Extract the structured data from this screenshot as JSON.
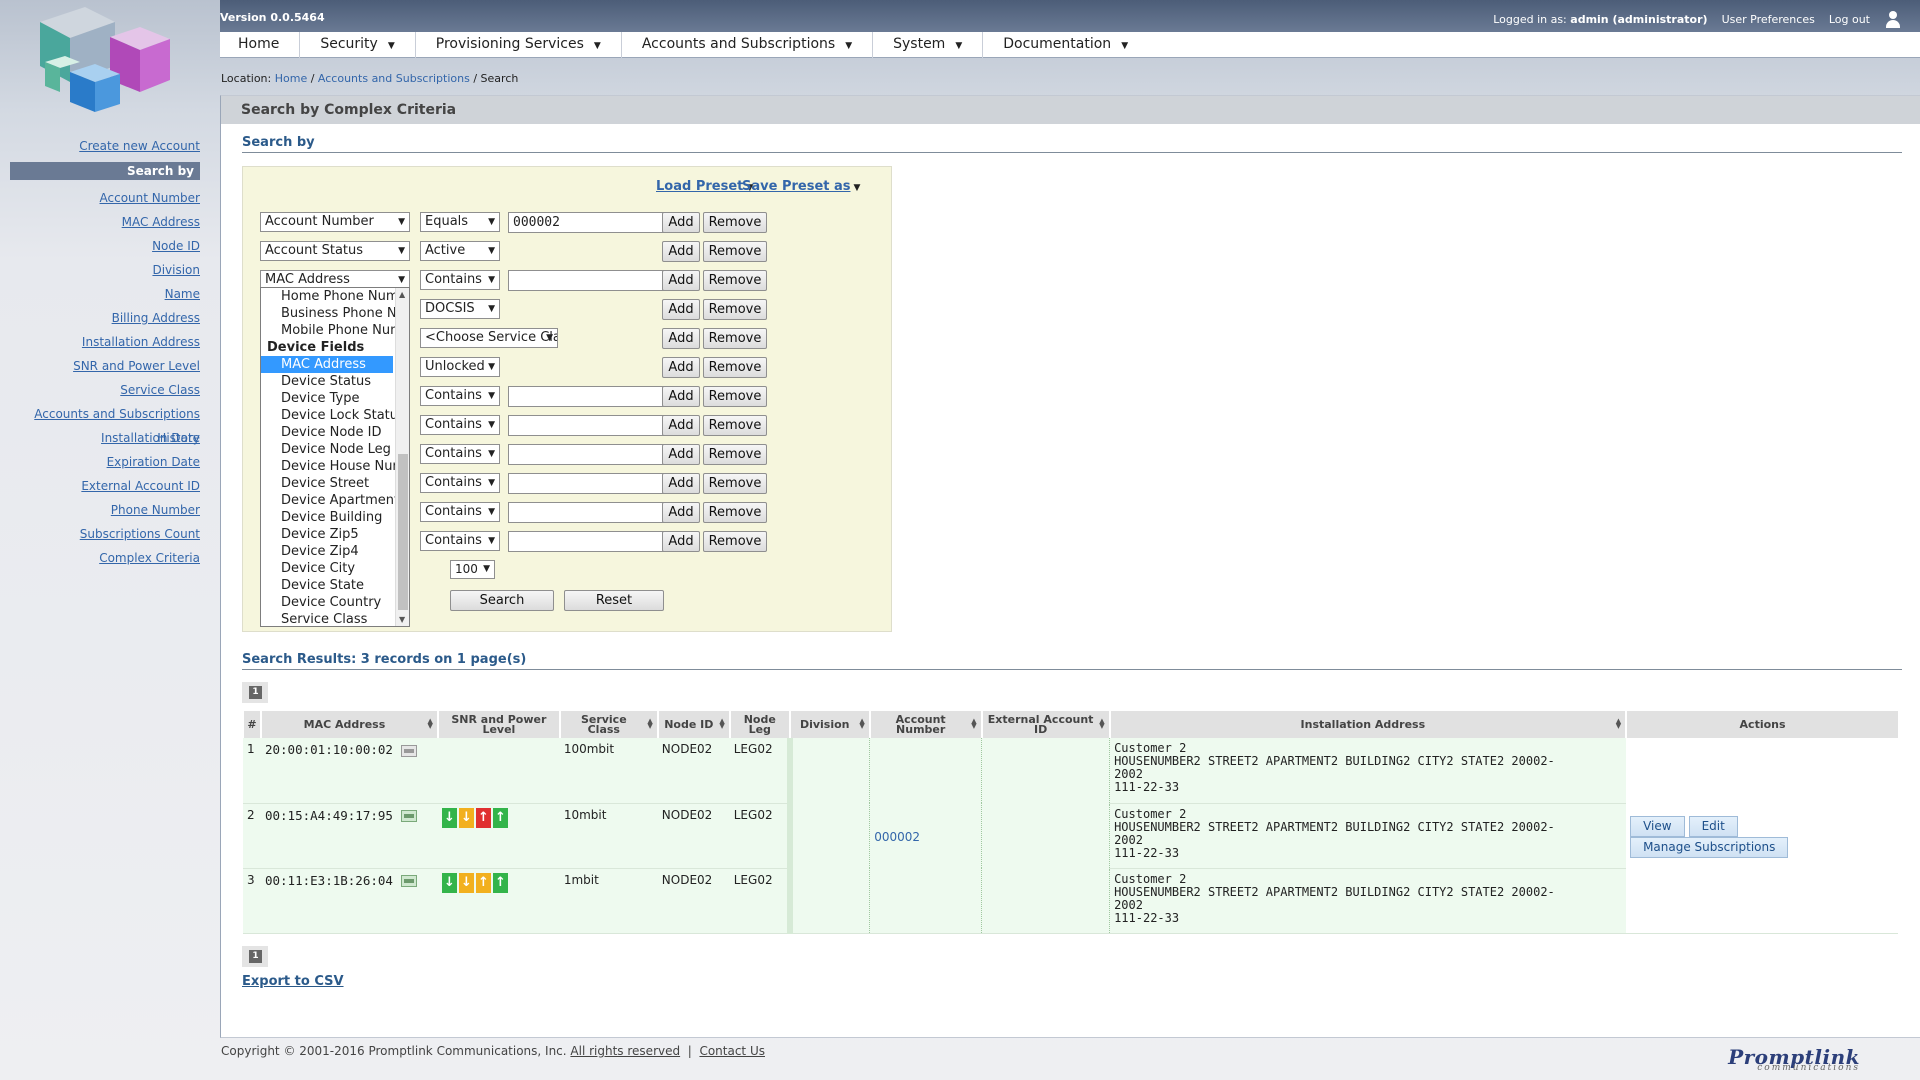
{
  "header": {
    "version": "Version 0.0.5464",
    "logged_in_label": "Logged in as:",
    "logged_in_user": "admin (administrator)",
    "user_preferences": "User Preferences",
    "logout": "Log out"
  },
  "nav": {
    "home": "Home",
    "security": "Security",
    "provisioning": "Provisioning Services",
    "accounts": "Accounts and Subscriptions",
    "system": "System",
    "documentation": "Documentation"
  },
  "breadcrumb": {
    "label": "Location:",
    "home": "Home",
    "accounts": "Accounts and Subscriptions",
    "current": "Search"
  },
  "sidebar": {
    "create": "Create new Account",
    "active": "Search by",
    "items": [
      "Account Number",
      "MAC Address",
      "Node ID",
      "Division",
      "Name",
      "Billing Address",
      "Installation Address",
      "SNR and Power Level",
      "Service Class",
      "Accounts and Subscriptions History",
      "Installation Date",
      "Expiration Date",
      "External Account ID",
      "Phone Number",
      "Subscriptions Count",
      "Complex Criteria"
    ]
  },
  "page": {
    "title": "Search by Complex Criteria",
    "search_by": "Search by",
    "load_preset": "Load Preset",
    "save_preset": "Save Preset as"
  },
  "criteria": {
    "field1": "Account Number",
    "field2": "Account Status",
    "field3": "MAC Address",
    "op1": "Equals",
    "val1": "000002",
    "status_value": "Active",
    "op3": "Contains",
    "docsis": "DOCSIS",
    "service_class": "<Choose Service Class>",
    "lock": "Unlocked",
    "contains": "Contains",
    "add": "Add",
    "remove": "Remove",
    "page_size": "100",
    "search": "Search",
    "reset": "Reset"
  },
  "dropdown": {
    "before": [
      "Home Phone Number",
      "Business Phone Number",
      "Mobile Phone Number"
    ],
    "group": "Device Fields",
    "selected": "MAC Address",
    "after": [
      "Device Status",
      "Device Type",
      "Device Lock Status",
      "Device Node ID",
      "Device Node Leg",
      "Device House Number",
      "Device Street",
      "Device Apartment",
      "Device Building",
      "Device Zip5",
      "Device Zip4",
      "Device City",
      "Device State",
      "Device Country",
      "Service Class"
    ]
  },
  "results": {
    "heading": "Search Results: 3 records on 1 page(s)",
    "page": "1",
    "columns": {
      "num": "#",
      "mac": "MAC Address",
      "snr": "SNR and Power Level",
      "service": "Service Class",
      "node": "Node ID",
      "leg": "Node Leg",
      "division": "Division",
      "account": "Account Number",
      "external": "External Account ID",
      "install": "Installation Address",
      "actions": "Actions"
    },
    "rows": [
      {
        "num": "1",
        "mac": "20:00:01:10:00:02",
        "service": "100mbit",
        "node": "NODE02",
        "leg": "LEG02",
        "addr1": "Customer 2",
        "addr2": "HOUSENUMBER2 STREET2 APARTMENT2 BUILDING2 CITY2 STATE2 20002-",
        "addr3": "2002",
        "addr4": "111-22-33"
      },
      {
        "num": "2",
        "mac": "00:15:A4:49:17:95",
        "service": "10mbit",
        "node": "NODE02",
        "leg": "LEG02",
        "addr1": "Customer 2",
        "addr2": "HOUSENUMBER2 STREET2 APARTMENT2 BUILDING2 CITY2 STATE2 20002-",
        "addr3": "2002",
        "addr4": "111-22-33"
      },
      {
        "num": "3",
        "mac": "00:11:E3:1B:26:04",
        "service": "1mbit",
        "node": "NODE02",
        "leg": "LEG02",
        "addr1": "Customer 2",
        "addr2": "HOUSENUMBER2 STREET2 APARTMENT2 BUILDING2 CITY2 STATE2 20002-",
        "addr3": "2002",
        "addr4": "111-22-33"
      }
    ],
    "account_link": "000002",
    "view": "View",
    "edit": "Edit",
    "manage": "Manage Subscriptions",
    "export": "Export to CSV"
  },
  "snr_glyphs": {
    "down": "↓",
    "up": "↑"
  },
  "colors": {
    "snr_good": "#33b44a",
    "snr_warn": "#f2b01e",
    "snr_bad": "#e03030",
    "header": "#4c5d78"
  },
  "footer": {
    "copyright": "Copyright © 2001-2016 Promptlink Communications, Inc.",
    "rights": "All rights reserved",
    "separator": "|",
    "contact": "Contact Us",
    "brand": "Promptlink",
    "brand_sub": "communications"
  }
}
